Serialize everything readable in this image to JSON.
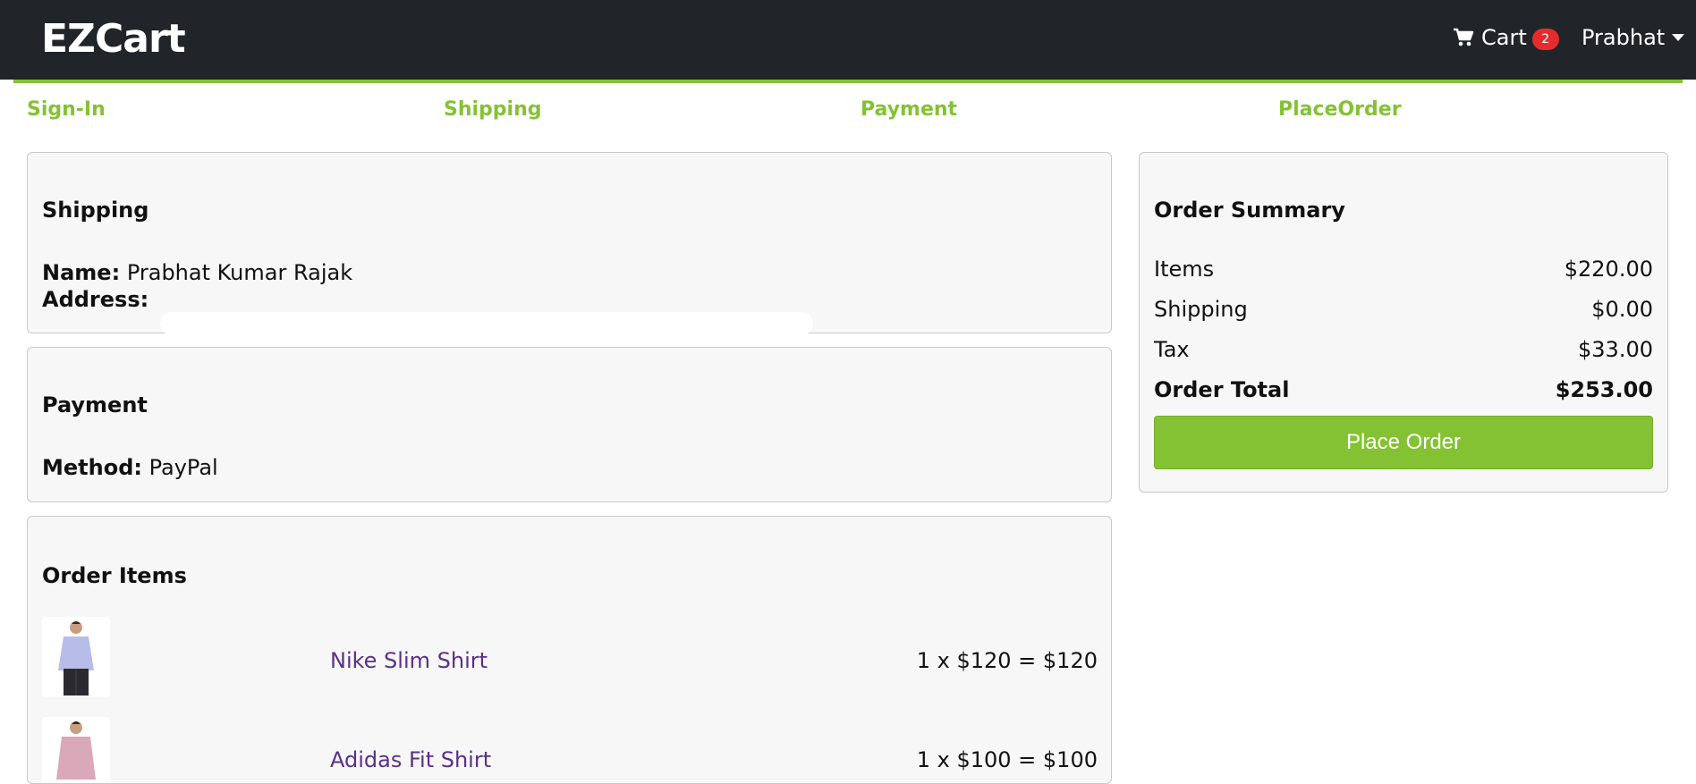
{
  "navbar": {
    "brand": "EZCart",
    "cart_label": "Cart",
    "cart_count": "2",
    "user_name": "Prabhat"
  },
  "steps": [
    "Sign-In",
    "Shipping",
    "Payment",
    "PlaceOrder"
  ],
  "shipping": {
    "title": "Shipping",
    "name_label": "Name:",
    "name_value": "Prabhat Kumar Rajak",
    "address_label": "Address:"
  },
  "payment": {
    "title": "Payment",
    "method_label": "Method:",
    "method_value": "PayPal"
  },
  "order_items": {
    "title": "Order Items",
    "items": [
      {
        "name": "Nike Slim Shirt",
        "price_line": "1 x $120 = $120"
      },
      {
        "name": "Adidas Fit Shirt",
        "price_line": "1 x $100 = $100"
      }
    ]
  },
  "summary": {
    "title": "Order Summary",
    "rows": [
      {
        "label": "Items",
        "value": "$220.00"
      },
      {
        "label": "Shipping",
        "value": "$0.00"
      },
      {
        "label": "Tax",
        "value": "$33.00"
      },
      {
        "label": "Order Total",
        "value": "$253.00"
      }
    ],
    "button_label": "Place Order"
  },
  "colors": {
    "navbar_bg": "#212529",
    "accent_green": "#84c234",
    "badge_red": "#e52c2c",
    "link_purple": "#5b2f8a"
  }
}
